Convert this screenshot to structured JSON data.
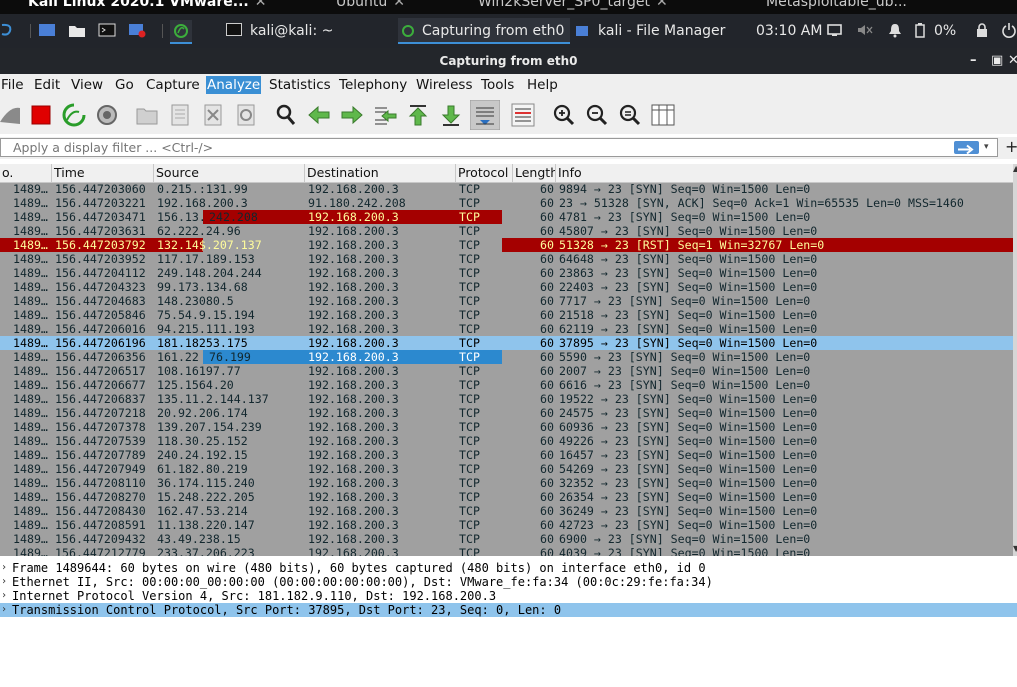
{
  "vm_tabs": [
    {
      "label": "Kali Linux 2020.1 VMware..."
    },
    {
      "label": "Ubuntu"
    },
    {
      "label": "Win2kServer_SP0_target"
    },
    {
      "label": "Metasploitable_ub..."
    }
  ],
  "panel": {
    "tasks": [
      {
        "label": "kali@kali: ~"
      },
      {
        "label": "Capturing from eth0"
      },
      {
        "label": "kali - File Manager"
      }
    ],
    "clock": "03:10 AM",
    "battery": "0%"
  },
  "window": {
    "title": "Capturing from eth0"
  },
  "menu": [
    "File",
    "Edit",
    "View",
    "Go",
    "Capture",
    "Analyze",
    "Statistics",
    "Telephony",
    "Wireless",
    "Tools",
    "Help"
  ],
  "menu_selected": "Analyze",
  "filter": {
    "placeholder": "Apply a display filter ... <Ctrl-/>"
  },
  "columns": [
    "o.",
    "Time",
    "Source",
    "Destination",
    "Protocol",
    "Length",
    "Info"
  ],
  "packets": [
    {
      "no": "1489…",
      "time": "156.447203060",
      "src": "0.215.:131.99",
      "dst": "192.168.200.3",
      "proto": "TCP",
      "len": "60",
      "info": "9894 → 23 [SYN] Seq=0 Win=1500 Len=0",
      "style": ""
    },
    {
      "no": "1489…",
      "time": "156.447203221",
      "src": "192.168.200.3",
      "dst": "91.180.242.208",
      "proto": "TCP",
      "len": "60",
      "info": "23 → 51328 [SYN, ACK] Seq=0 Ack=1 Win=65535 Len=0 MSS=1460",
      "style": ""
    },
    {
      "no": "1489…",
      "time": "156.447203471",
      "src": "156.13.",
      "src2": "242.208",
      "dst": "192.168.200.3",
      "proto": "TCP",
      "len": "60",
      "info": "4781 → 23 [SYN] Seq=0 Win=1500 Len=0",
      "style": "hl1"
    },
    {
      "no": "1489…",
      "time": "156.447203631",
      "src": "62.222.24.96",
      "dst": "192.168.200.3",
      "proto": "TCP",
      "len": "60",
      "info": "45807 → 23 [SYN] Seq=0 Win=1500 Len=0",
      "style": ""
    },
    {
      "no": "1489…",
      "time": "156.447203792",
      "src": "132.14$.207.137",
      "dst": "192.168.200.3",
      "proto": "TCP",
      "len": "60",
      "info": "51328 → 23 [RST] Seq=1 Win=32767 Len=0",
      "style": "rst"
    },
    {
      "no": "1489…",
      "time": "156.447203952",
      "src": "117.17.189.153",
      "dst": "192.168.200.3",
      "proto": "TCP",
      "len": "60",
      "info": "64648 → 23 [SYN] Seq=0 Win=1500 Len=0",
      "style": ""
    },
    {
      "no": "1489…",
      "time": "156.447204112",
      "src": "249.148.204.244",
      "dst": "192.168.200.3",
      "proto": "TCP",
      "len": "60",
      "info": "23863 → 23 [SYN] Seq=0 Win=1500 Len=0",
      "style": ""
    },
    {
      "no": "1489…",
      "time": "156.447204323",
      "src": "99.173.134.68",
      "dst": "192.168.200.3",
      "proto": "TCP",
      "len": "60",
      "info": "22403 → 23 [SYN] Seq=0 Win=1500 Len=0",
      "style": ""
    },
    {
      "no": "1489…",
      "time": "156.447204683",
      "src": "148.23080.5",
      "dst": "192.168.200.3",
      "proto": "TCP",
      "len": "60",
      "info": "7717 → 23 [SYN] Seq=0 Win=1500 Len=0",
      "style": ""
    },
    {
      "no": "1489…",
      "time": "156.447205846",
      "src": "75.54.9.15.194",
      "dst": "192.168.200.3",
      "proto": "TCP",
      "len": "60",
      "info": "21518 → 23 [SYN] Seq=0 Win=1500 Len=0",
      "style": ""
    },
    {
      "no": "1489…",
      "time": "156.447206016",
      "src": "94.215.111.193",
      "dst": "192.168.200.3",
      "proto": "TCP",
      "len": "60",
      "info": "62119 → 23 [SYN] Seq=0 Win=1500 Len=0",
      "style": ""
    },
    {
      "no": "1489…",
      "time": "156.447206196",
      "src": "181.18253.175",
      "dst": "192.168.200.3",
      "proto": "TCP",
      "len": "60",
      "info": "37895 → 23 [SYN] Seq=0 Win=1500 Len=0",
      "style": "sel"
    },
    {
      "no": "1489…",
      "time": "156.447206356",
      "src": "161.22",
      "src2": "76.199",
      "dst": "192.168.200.3",
      "proto": "TCP",
      "len": "60",
      "info": "5590 → 23 [SYN] Seq=0 Win=1500 Len=0",
      "style": "hl2"
    },
    {
      "no": "1489…",
      "time": "156.447206517",
      "src": "108.16197.77",
      "dst": "192.168.200.3",
      "proto": "TCP",
      "len": "60",
      "info": "2007 → 23 [SYN] Seq=0 Win=1500 Len=0",
      "style": ""
    },
    {
      "no": "1489…",
      "time": "156.447206677",
      "src": "125.1564.20",
      "dst": "192.168.200.3",
      "proto": "TCP",
      "len": "60",
      "info": "6616 → 23 [SYN] Seq=0 Win=1500 Len=0",
      "style": ""
    },
    {
      "no": "1489…",
      "time": "156.447206837",
      "src": "135.11.2.144.137",
      "dst": "192.168.200.3",
      "proto": "TCP",
      "len": "60",
      "info": "19522 → 23 [SYN] Seq=0 Win=1500 Len=0",
      "style": ""
    },
    {
      "no": "1489…",
      "time": "156.447207218",
      "src": "20.92.206.174",
      "dst": "192.168.200.3",
      "proto": "TCP",
      "len": "60",
      "info": "24575 → 23 [SYN] Seq=0 Win=1500 Len=0",
      "style": ""
    },
    {
      "no": "1489…",
      "time": "156.447207378",
      "src": "139.207.154.239",
      "dst": "192.168.200.3",
      "proto": "TCP",
      "len": "60",
      "info": "60936 → 23 [SYN] Seq=0 Win=1500 Len=0",
      "style": ""
    },
    {
      "no": "1489…",
      "time": "156.447207539",
      "src": "118.30.25.152",
      "dst": "192.168.200.3",
      "proto": "TCP",
      "len": "60",
      "info": "49226 → 23 [SYN] Seq=0 Win=1500 Len=0",
      "style": ""
    },
    {
      "no": "1489…",
      "time": "156.447207789",
      "src": "240.24.192.15",
      "dst": "192.168.200.3",
      "proto": "TCP",
      "len": "60",
      "info": "16457 → 23 [SYN] Seq=0 Win=1500 Len=0",
      "style": ""
    },
    {
      "no": "1489…",
      "time": "156.447207949",
      "src": "61.182.80.219",
      "dst": "192.168.200.3",
      "proto": "TCP",
      "len": "60",
      "info": "54269 → 23 [SYN] Seq=0 Win=1500 Len=0",
      "style": ""
    },
    {
      "no": "1489…",
      "time": "156.447208110",
      "src": "36.174.115.240",
      "dst": "192.168.200.3",
      "proto": "TCP",
      "len": "60",
      "info": "32352 → 23 [SYN] Seq=0 Win=1500 Len=0",
      "style": ""
    },
    {
      "no": "1489…",
      "time": "156.447208270",
      "src": "15.248.222.205",
      "dst": "192.168.200.3",
      "proto": "TCP",
      "len": "60",
      "info": "26354 → 23 [SYN] Seq=0 Win=1500 Len=0",
      "style": ""
    },
    {
      "no": "1489…",
      "time": "156.447208430",
      "src": "162.47.53.214",
      "dst": "192.168.200.3",
      "proto": "TCP",
      "len": "60",
      "info": "36249 → 23 [SYN] Seq=0 Win=1500 Len=0",
      "style": ""
    },
    {
      "no": "1489…",
      "time": "156.447208591",
      "src": "11.138.220.147",
      "dst": "192.168.200.3",
      "proto": "TCP",
      "len": "60",
      "info": "42723 → 23 [SYN] Seq=0 Win=1500 Len=0",
      "style": ""
    },
    {
      "no": "1489…",
      "time": "156.447209432",
      "src": "43.49.238.15",
      "dst": "192.168.200.3",
      "proto": "TCP",
      "len": "60",
      "info": "6900 → 23 [SYN] Seq=0 Win=1500 Len=0",
      "style": ""
    },
    {
      "no": "1489…",
      "time": "156.447212779",
      "src": "233.37.206.223",
      "dst": "192.168.200.3",
      "proto": "TCP",
      "len": "60",
      "info": "4039 → 23 [SYN] Seq=0 Win=1500 Len=0",
      "style": ""
    }
  ],
  "details": [
    {
      "text": "Frame 1489644: 60 bytes on wire (480 bits), 60 bytes captured (480 bits) on interface eth0, id 0",
      "selected": false
    },
    {
      "text": "Ethernet II, Src: 00:00:00_00:00:00 (00:00:00:00:00:00), Dst: VMware_fe:fa:34 (00:0c:29:fe:fa:34)",
      "selected": false
    },
    {
      "text": "Internet Protocol Version 4, Src: 181.182.9.110, Dst: 192.168.200.3",
      "selected": false
    },
    {
      "text": "Transmission Control Protocol, Src Port: 37895, Dst Port: 23, Seq: 0, Len: 0",
      "selected": true
    }
  ],
  "colors": {
    "rst_bg": "#a40000",
    "rst_fg": "#fffc9c",
    "selected_bg": "#8fc4ec",
    "list_bg": "#a0a0a0",
    "accent": "#3a8fd4"
  }
}
